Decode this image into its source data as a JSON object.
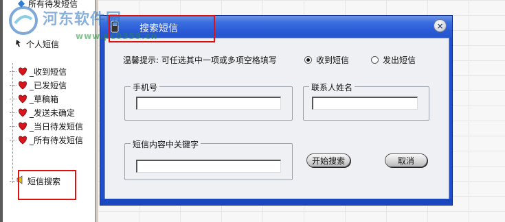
{
  "watermark": {
    "name": "河东软件园",
    "url": "www.pc0359.cn"
  },
  "tree": {
    "top_item": "所有待发短信",
    "personal": "个人短信",
    "items": [
      "_收到短信",
      "_已发短信",
      "_草稿箱",
      "_发送未确定",
      "_当日待发短信",
      "_所有待发短信"
    ],
    "search": "短信搜索"
  },
  "dialog": {
    "title": "搜索短信",
    "close": "×",
    "hint": "温馨提示: 可任选其中一项或多项空格填写",
    "radio_received": "收到短信",
    "radio_sent": "发出短信",
    "selected_radio": "收到短信",
    "phone_label": "手机号",
    "phone_value": "",
    "contact_label": "联系人姓名",
    "contact_value": "",
    "keyword_label": "短信内容中关键字",
    "keyword_value": "",
    "search_button": "开始搜索",
    "cancel_button": "取消"
  },
  "colors": {
    "dialog_blue": "#1f4fc9",
    "highlight_red": "#e01010",
    "heart_red": "#d8141c"
  }
}
